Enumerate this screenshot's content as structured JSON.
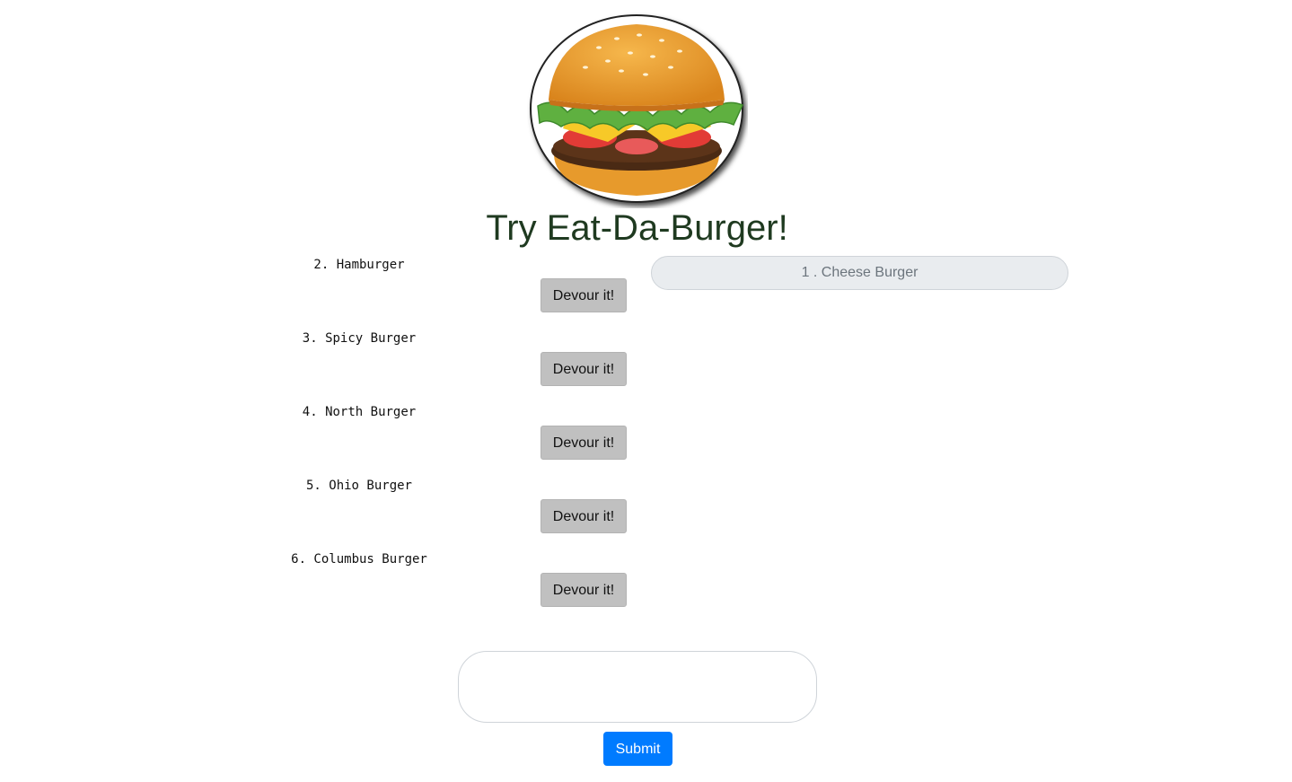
{
  "header": {
    "logo_icon": "burger-logo-icon",
    "title": "Try Eat-Da-Burger!"
  },
  "burgers_available": [
    {
      "label": "2. Hamburger",
      "button_label": "Devour it!"
    },
    {
      "label": "3. Spicy Burger",
      "button_label": "Devour it!"
    },
    {
      "label": "4. North Burger",
      "button_label": "Devour it!"
    },
    {
      "label": "5. Ohio Burger",
      "button_label": "Devour it!"
    },
    {
      "label": "6. Columbus Burger",
      "button_label": "Devour it!"
    }
  ],
  "burgers_devoured": [
    {
      "label": "1 . Cheese Burger"
    }
  ],
  "form": {
    "input_value": "",
    "input_placeholder": "",
    "submit_label": "Submit"
  },
  "colors": {
    "title": "#1f3a20",
    "devour_button": "#c0c0c0",
    "devoured_pill": "#e9ecef",
    "submit_button": "#007bff"
  }
}
